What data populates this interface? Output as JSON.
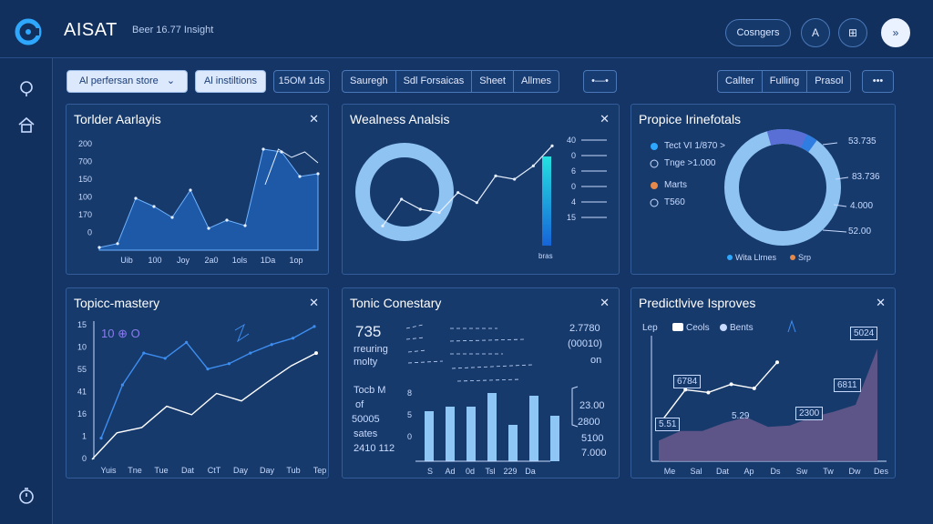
{
  "header": {
    "app_title": "AISAT",
    "subtitle": "Beer 16.77 Insight",
    "pill_label": "Cosngers",
    "circle_a": "A",
    "circle_grid": "⊞",
    "circle_forward": "»"
  },
  "toolbar": {
    "select_value": "Al perfersan store",
    "btn_institions": "Al instiltions",
    "btn_15m": "15OM 1ds",
    "group1": [
      "Sauregh",
      "Sdl Forsaicas",
      "Sheet",
      "Allmes"
    ],
    "toggle_label": "•—•",
    "group2": [
      "Callter",
      "Fulling",
      "Prasol"
    ],
    "more_label": "•••"
  },
  "panels": {
    "p1": {
      "title": "Torlder Aarlayis",
      "y_ticks": [
        "200",
        "700",
        "150",
        "100",
        "170",
        "0"
      ],
      "x_ticks": [
        "Uib",
        "100",
        "Joy",
        "2a0",
        "1ols",
        "1Da",
        "1op"
      ]
    },
    "p2": {
      "title": "Wealness Analsis",
      "scale_values": [
        "40",
        "0",
        "6",
        "0",
        "4",
        "15"
      ],
      "scale_footer": "bras"
    },
    "p3": {
      "title": "Propice Irinefotals",
      "legend": [
        "Tect VI 1/870 >",
        "Tnge >1.000",
        "Marts",
        "T560"
      ],
      "side_values": [
        "53.735",
        "83.736",
        "4.000",
        "52.00"
      ],
      "footer": [
        "Wita Llrnes",
        "Srp"
      ]
    },
    "p4": {
      "title": "Topicc-mastery",
      "y_ticks": [
        "15",
        "10",
        "55",
        "41",
        "16",
        "1",
        "0"
      ],
      "x_ticks": [
        "Yuis",
        "Tne",
        "Tue",
        "Dat",
        "CtT",
        "Day",
        "Day",
        "Tub",
        "Tep"
      ],
      "annotation": "10 ⊕ O"
    },
    "p5": {
      "title": "Tonic Conestary",
      "big_value": "735",
      "text_lines": [
        "rreuring",
        "molty"
      ],
      "left_stats": [
        "Tocb M",
        "of",
        "50005",
        "sates",
        "2410 112"
      ],
      "right_stats": [
        "2.7780",
        "(00010)",
        "on"
      ],
      "right_values": [
        "23.00",
        "2800",
        "5100",
        "7.000"
      ],
      "bar_axis": [
        "8",
        "5",
        "0"
      ],
      "x_ticks": [
        "S",
        "Ad",
        "0d",
        "Tsl",
        "229",
        "Da"
      ]
    },
    "p6": {
      "title": "Predictlvive Isproves",
      "legend": [
        "Lep",
        "Ceols",
        "Bents"
      ],
      "annotations": [
        "5024",
        "6784",
        "6811",
        "2300",
        "5.29",
        "5.51"
      ],
      "x_ticks": [
        "Me",
        "Sal",
        "Dat",
        "Ap",
        "Ds",
        "Sw",
        "Tw",
        "Dw",
        "Des"
      ]
    }
  },
  "chart_data": [
    {
      "type": "area",
      "title": "Torlder Aarlayis",
      "y_ticks": [
        "200",
        "700",
        "150",
        "100",
        "170",
        "0"
      ],
      "x_ticks": [
        "Uib",
        "100",
        "Joy",
        "2a0",
        "1ols",
        "1Da",
        "1op"
      ],
      "values": [
        5,
        12,
        95,
        80,
        60,
        110,
        40,
        55,
        45,
        185,
        180,
        135,
        140
      ],
      "line2": [
        120,
        185,
        170,
        180,
        160
      ]
    },
    {
      "type": "line",
      "title": "Wealness Analsis",
      "values": [
        20,
        60,
        45,
        40,
        70,
        55,
        95,
        90,
        110,
        140
      ]
    },
    {
      "type": "pie",
      "title": "Propice Irinefotals",
      "values": [
        10,
        7,
        83
      ]
    },
    {
      "type": "line",
      "title": "Topicc-mastery",
      "series": [
        {
          "values": [
            2,
            7,
            10,
            9.5,
            11,
            8.5,
            9,
            10,
            10.8,
            11.4,
            12.5
          ]
        },
        {
          "values": [
            0,
            2.5,
            3,
            5,
            4.2,
            6.2,
            5.5,
            7.2,
            8.8,
            10
          ]
        }
      ]
    },
    {
      "type": "bar",
      "title": "Tonic Conestary",
      "values": [
        5.5,
        6,
        6,
        7.5,
        4,
        7.2,
        5
      ]
    },
    {
      "type": "area",
      "title": "Predictlvive Isproves",
      "values": [
        1.5,
        2.2,
        2.2,
        2.8,
        3.2,
        2.5,
        2.6,
        3.2,
        3.6,
        4.1,
        8.2
      ],
      "line": [
        3,
        5.2,
        5.0,
        5.6,
        5.3,
        7.2
      ]
    }
  ]
}
